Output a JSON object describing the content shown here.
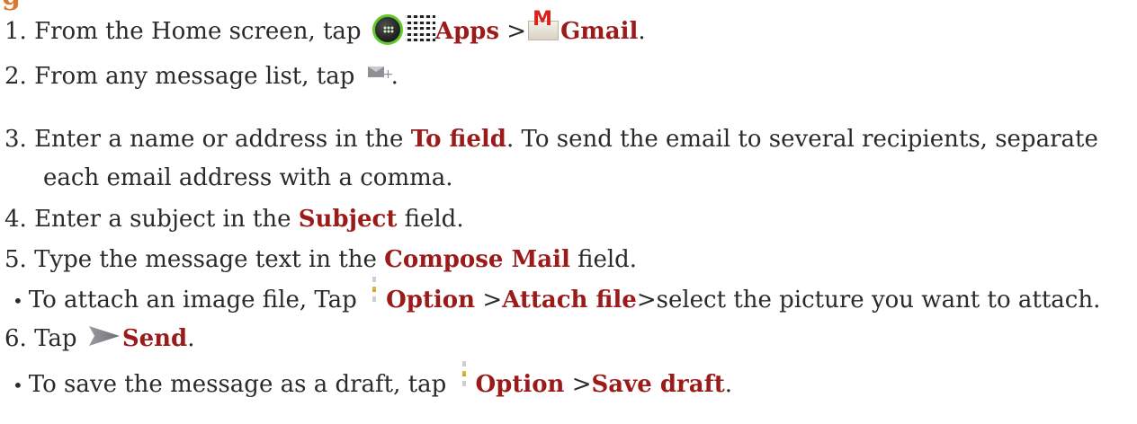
{
  "heading_fragment": "g",
  "steps": {
    "s1": {
      "prefix": "1. From the Home screen, tap ",
      "apps": "Apps",
      "sep": " >",
      "gmail": "Gmail",
      "end": "."
    },
    "s2": {
      "prefix": "2. From any message list, tap ",
      "end": "."
    },
    "s3": {
      "prefix": "3. Enter a name or address in the ",
      "to_field": "To field",
      "rest": ". To send the email to several recipients, separate",
      "cont": "each email address with a comma."
    },
    "s4": {
      "prefix": "4. Enter a subject in the ",
      "subject": "Subject",
      "rest": " field."
    },
    "s5": {
      "prefix": "5. Type the message text in the ",
      "compose": "Compose Mail",
      "rest": " field."
    },
    "b1": {
      "prefix": "To attach an image file, Tap ",
      "option": "Option",
      "sep": " >",
      "attach": "Attach file",
      "rest": ">select the picture you want to attach."
    },
    "s6": {
      "prefix": "6. Tap ",
      "send": "Send",
      "end": "."
    },
    "b2": {
      "prefix": "To save the message as a draft, tap ",
      "option": "Option",
      "sep": " >",
      "save": "Save draft",
      "end": "."
    }
  },
  "icons": {
    "launcher": "app-launcher-icon",
    "apps_grid": "apps-grid-icon",
    "gmail": "gmail-icon",
    "compose": "compose-mail-icon",
    "option": "option-menu-icon",
    "send": "send-arrow-icon"
  },
  "colors": {
    "highlight": "#9b1b1b",
    "text": "#2a2a2a",
    "launcher_ring": "#63c928",
    "gmail_m": "#d9211d"
  }
}
